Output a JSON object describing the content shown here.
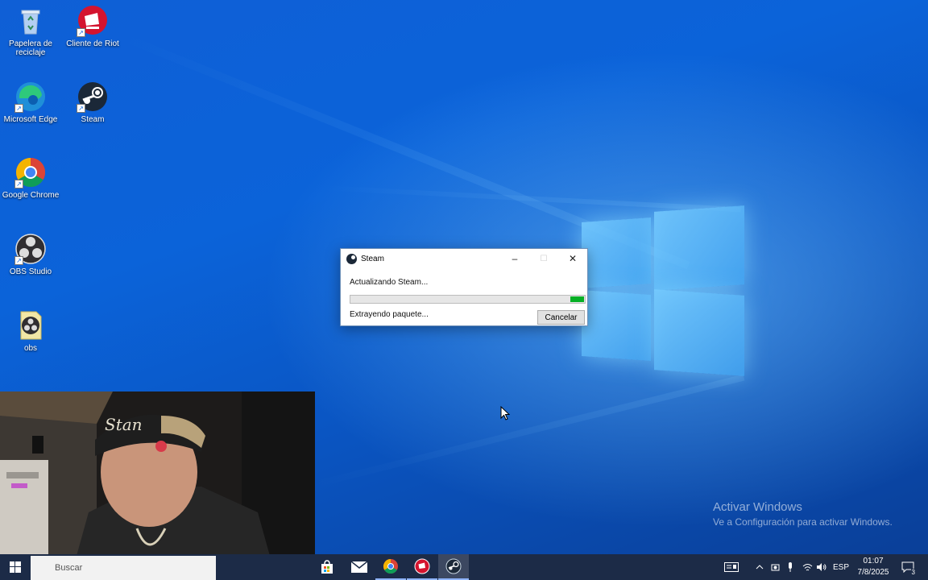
{
  "desktop": {
    "icons": [
      {
        "label": "Papelera de reciclaje",
        "icon": "recycle-bin-icon"
      },
      {
        "label": "Cliente de Riot",
        "icon": "riot-client-icon"
      },
      {
        "label": "Microsoft Edge",
        "icon": "edge-icon"
      },
      {
        "label": "Steam",
        "icon": "steam-icon"
      },
      {
        "label": "Google Chrome",
        "icon": "chrome-icon"
      },
      {
        "label": "OBS Studio",
        "icon": "obs-icon"
      },
      {
        "label": "obs",
        "icon": "obs-file-icon"
      }
    ],
    "watermark": {
      "line1": "Activar Windows",
      "line2": "Ve a Configuración para activar Windows."
    }
  },
  "dialog": {
    "title": "Steam",
    "status": "Actualizando Steam...",
    "progress": 0.94,
    "substatus": "Extrayendo paquete...",
    "cancel_label": "Cancelar",
    "minimize_glyph": "–",
    "maximize_glyph": "☐",
    "close_glyph": "✕"
  },
  "webcam": {
    "cap_text": "Stan"
  },
  "taskbar": {
    "search_placeholder": "Buscar",
    "apps": [
      "store-icon",
      "mail-icon",
      "chrome-icon",
      "riot-client-icon",
      "steam-icon"
    ],
    "tray": {
      "language": "ESP",
      "time": "01:07",
      "date": "7/8/2025",
      "notifications": "3"
    }
  },
  "colors": {
    "progress_fill": "#06b025",
    "taskbar": "#1c2b47",
    "desktop": "#0b63d9"
  }
}
